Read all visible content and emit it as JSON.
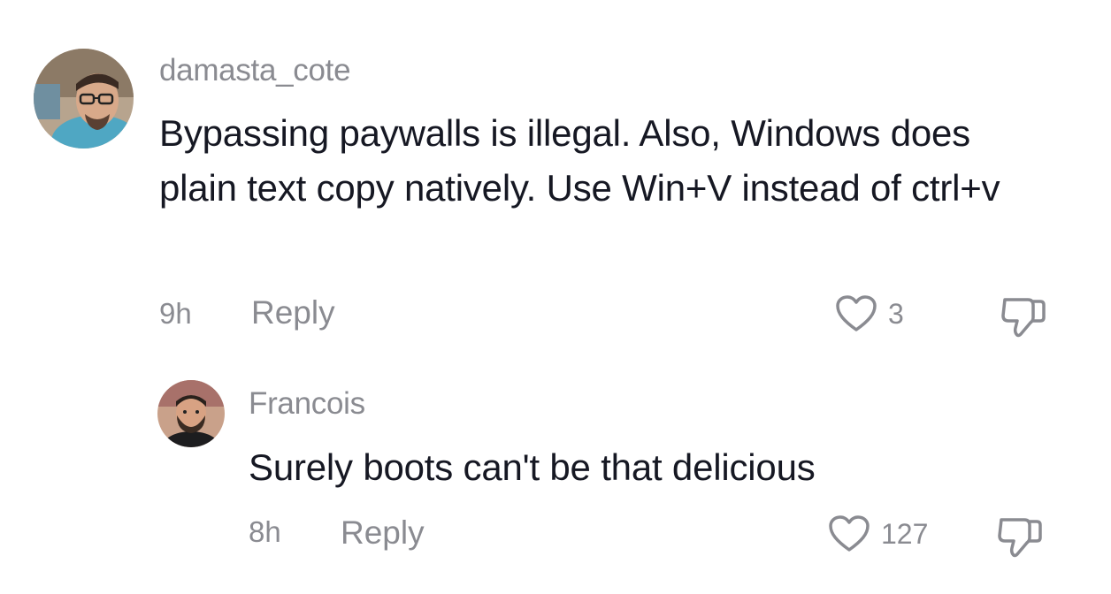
{
  "comments": [
    {
      "username": "damasta_cote",
      "text": "Bypassing paywalls is illegal. Also, Windows does plain text copy natively. Use Win+V instead of ctrl+v",
      "time": "9h",
      "reply_label": "Reply",
      "likes": "3",
      "avatar_icon": "avatar-glasses-man",
      "like_icon": "heart-outline-icon",
      "dislike_icon": "thumbs-down-icon"
    },
    {
      "username": "Francois",
      "text": "Surely boots can't be that delicious",
      "time": "8h",
      "reply_label": "Reply",
      "likes": "127",
      "avatar_icon": "avatar-bearded-man",
      "like_icon": "heart-outline-icon",
      "dislike_icon": "thumbs-down-icon"
    }
  ],
  "colors": {
    "text": "#161823",
    "muted": "#8a8b91",
    "background": "#ffffff"
  }
}
